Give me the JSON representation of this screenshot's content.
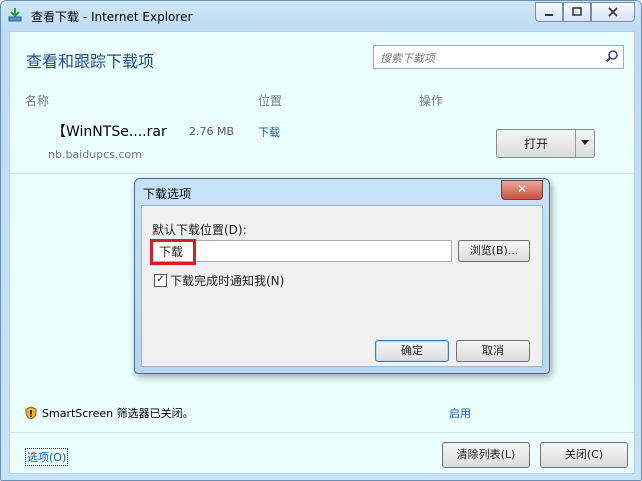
{
  "window": {
    "title": "查看下载 - Internet Explorer"
  },
  "main": {
    "heading": "查看和跟踪下载项",
    "search_placeholder": "搜索下载项",
    "columns": {
      "name": "名称",
      "location": "位置",
      "action": "操作"
    },
    "download": {
      "filename": "【WinNTSe....rar",
      "size": "2.76 MB",
      "location": "下载",
      "source": "nb.baidupcs.com",
      "open_label": "打开"
    }
  },
  "footer": {
    "smartscreen": "SmartScreen 筛选器已关闭。",
    "enable": "启用",
    "options": "选项(O)",
    "clear_list": "清除列表(L)",
    "close": "关闭(C)"
  },
  "dialog": {
    "title": "下载选项",
    "default_location_label": "默认下载位置(D):",
    "location_value": "下载",
    "browse": "浏览(B)...",
    "notify_label": "下载完成时通知我(N)",
    "notify_checked": true,
    "ok": "确定",
    "cancel": "取消"
  },
  "colors": {
    "accent": "#1f4b8f",
    "link": "#1a5bb5",
    "highlight": "#d22026",
    "background": "#ebfffe"
  }
}
